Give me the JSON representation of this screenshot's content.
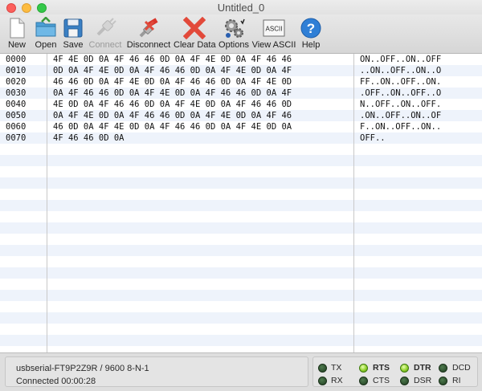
{
  "window": {
    "title": "Untitled_0"
  },
  "toolbar": {
    "items": [
      {
        "label": "New",
        "icon": "new-document-icon",
        "enabled": true
      },
      {
        "label": "Open",
        "icon": "open-folder-icon",
        "enabled": true
      },
      {
        "label": "Save",
        "icon": "save-disk-icon",
        "enabled": true
      },
      {
        "label": "Connect",
        "icon": "connect-plug-icon",
        "enabled": false
      },
      {
        "label": "Disconnect",
        "icon": "disconnect-plug-icon",
        "enabled": true
      },
      {
        "label": "Clear Data",
        "icon": "clear-x-icon",
        "enabled": true
      },
      {
        "label": "Options",
        "icon": "gears-options-icon",
        "enabled": true
      },
      {
        "label": "View ASCII",
        "icon": "ascii-view-icon",
        "enabled": true
      },
      {
        "label": "Help",
        "icon": "help-icon",
        "enabled": true
      }
    ],
    "ascii_icon_text": "ASCII",
    "help_icon_text": "?"
  },
  "colors": {
    "stripe": "#eef3fb",
    "clear_red": "#e2493a",
    "help_blue": "#2f7fd6",
    "led_on": "#8fd12b",
    "led_off": "#2e5a2e"
  },
  "data_rows": [
    {
      "addr": "0000",
      "hex": "4F 4E 0D 0A 4F 46 46 0D 0A 4F 4E 0D 0A 4F 46 46",
      "ascii": "ON..OFF..ON..OFF"
    },
    {
      "addr": "0010",
      "hex": "0D 0A 4F 4E 0D 0A 4F 46 46 0D 0A 4F 4E 0D 0A 4F",
      "ascii": "..ON..OFF..ON..O"
    },
    {
      "addr": "0020",
      "hex": "46 46 0D 0A 4F 4E 0D 0A 4F 46 46 0D 0A 4F 4E 0D",
      "ascii": "FF..ON..OFF..ON."
    },
    {
      "addr": "0030",
      "hex": "0A 4F 46 46 0D 0A 4F 4E 0D 0A 4F 46 46 0D 0A 4F",
      "ascii": ".OFF..ON..OFF..O"
    },
    {
      "addr": "0040",
      "hex": "4E 0D 0A 4F 46 46 0D 0A 4F 4E 0D 0A 4F 46 46 0D",
      "ascii": "N..OFF..ON..OFF."
    },
    {
      "addr": "0050",
      "hex": "0A 4F 4E 0D 0A 4F 46 46 0D 0A 4F 4E 0D 0A 4F 46",
      "ascii": ".ON..OFF..ON..OF"
    },
    {
      "addr": "0060",
      "hex": "46 0D 0A 4F 4E 0D 0A 4F 46 46 0D 0A 4F 4E 0D 0A",
      "ascii": "F..ON..OFF..ON.."
    },
    {
      "addr": "0070",
      "hex": "4F 46 46 0D 0A",
      "ascii": "OFF.."
    }
  ],
  "status": {
    "port": "usbserial-FT9P2Z9R / 9600 8-N-1",
    "connection": "Connected 00:00:28"
  },
  "signals": [
    {
      "label": "TX",
      "on": false,
      "active": false
    },
    {
      "label": "RX",
      "on": false,
      "active": false
    },
    {
      "label": "RTS",
      "on": true,
      "active": true
    },
    {
      "label": "CTS",
      "on": false,
      "active": false
    },
    {
      "label": "DTR",
      "on": true,
      "active": true
    },
    {
      "label": "DSR",
      "on": false,
      "active": false
    },
    {
      "label": "DCD",
      "on": false,
      "active": false
    },
    {
      "label": "RI",
      "on": false,
      "active": false
    }
  ]
}
